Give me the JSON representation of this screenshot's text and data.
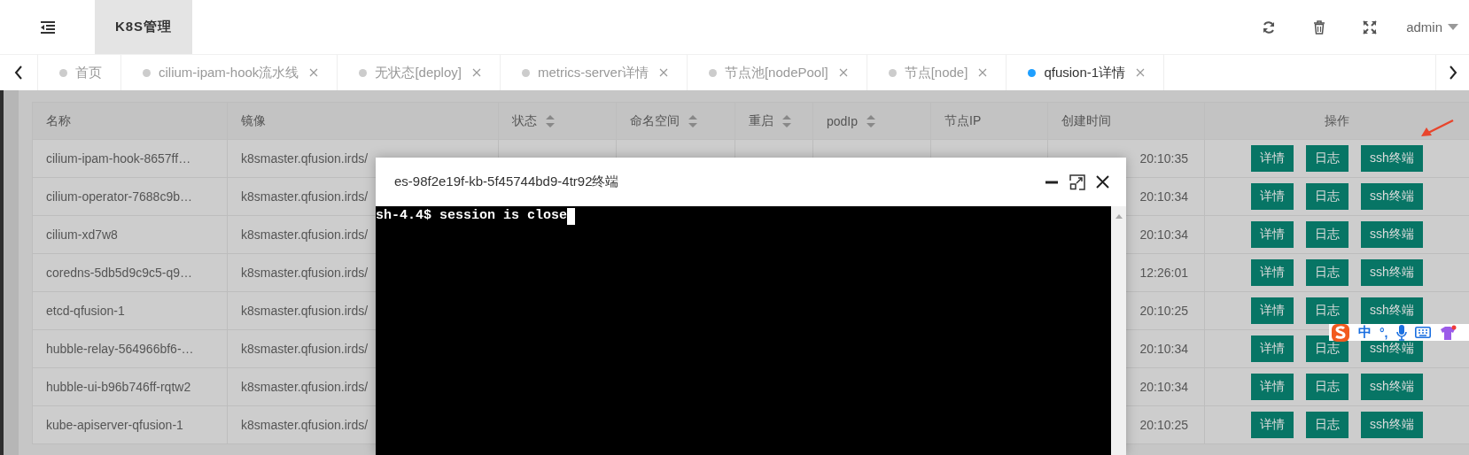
{
  "header": {
    "title_tab": "K8S管理",
    "user": "admin"
  },
  "tabs": [
    {
      "label": "首页",
      "closable": false,
      "selected": false
    },
    {
      "label": "cilium-ipam-hook流水线",
      "closable": true,
      "selected": false
    },
    {
      "label": "无状态[deploy]",
      "closable": true,
      "selected": false
    },
    {
      "label": "metrics-server详情",
      "closable": true,
      "selected": false
    },
    {
      "label": "节点池[nodePool]",
      "closable": true,
      "selected": false
    },
    {
      "label": "节点[node]",
      "closable": true,
      "selected": false
    },
    {
      "label": "qfusion-1详情",
      "closable": true,
      "selected": true
    }
  ],
  "table": {
    "columns": [
      {
        "label": "名称",
        "sortable": false
      },
      {
        "label": "镜像",
        "sortable": false
      },
      {
        "label": "状态",
        "sortable": true
      },
      {
        "label": "命名空间",
        "sortable": true
      },
      {
        "label": "重启",
        "sortable": true
      },
      {
        "label": "podIp",
        "sortable": true
      },
      {
        "label": "节点IP",
        "sortable": false
      },
      {
        "label": "创建时间",
        "sortable": false
      },
      {
        "label": "操作",
        "sortable": false
      }
    ],
    "rows": [
      {
        "name": "cilium-ipam-hook-8657ff…",
        "image": "k8smaster.qfusion.irds/",
        "created": "20:10:35",
        "actions": [
          "详情",
          "日志",
          "ssh终端"
        ]
      },
      {
        "name": "cilium-operator-7688c9b…",
        "image": "k8smaster.qfusion.irds/",
        "created": "20:10:34",
        "actions": [
          "详情",
          "日志",
          "ssh终端"
        ]
      },
      {
        "name": "cilium-xd7w8",
        "image": "k8smaster.qfusion.irds/",
        "created": "20:10:34",
        "actions": [
          "详情",
          "日志",
          "ssh终端"
        ]
      },
      {
        "name": "coredns-5db5d9c9c5-q9…",
        "image": "k8smaster.qfusion.irds/",
        "created": "12:26:01",
        "actions": [
          "详情",
          "日志",
          "ssh终端"
        ]
      },
      {
        "name": "etcd-qfusion-1",
        "image": "k8smaster.qfusion.irds/",
        "created": "20:10:25",
        "actions": [
          "详情",
          "日志",
          "ssh终端"
        ]
      },
      {
        "name": "hubble-relay-564966bf6-…",
        "image": "k8smaster.qfusion.irds/",
        "created": "20:10:34",
        "actions": [
          "详情",
          "日志",
          "ssh终端"
        ]
      },
      {
        "name": "hubble-ui-b96b746ff-rqtw2",
        "image": "k8smaster.qfusion.irds/",
        "created": "20:10:34",
        "actions": [
          "详情",
          "日志",
          "ssh终端"
        ]
      },
      {
        "name": "kube-apiserver-qfusion-1",
        "image": "k8smaster.qfusion.irds/",
        "created": "20:10:25",
        "actions": [
          "详情",
          "日志",
          "ssh终端"
        ]
      }
    ]
  },
  "terminal_dialog": {
    "title": "es-98f2e19f-kb-5f45744bd9-4tr92终端",
    "output": "sh-4.4$ session is close"
  },
  "ime_toolbar": {
    "mode": "中",
    "punctuation": "°,"
  }
}
